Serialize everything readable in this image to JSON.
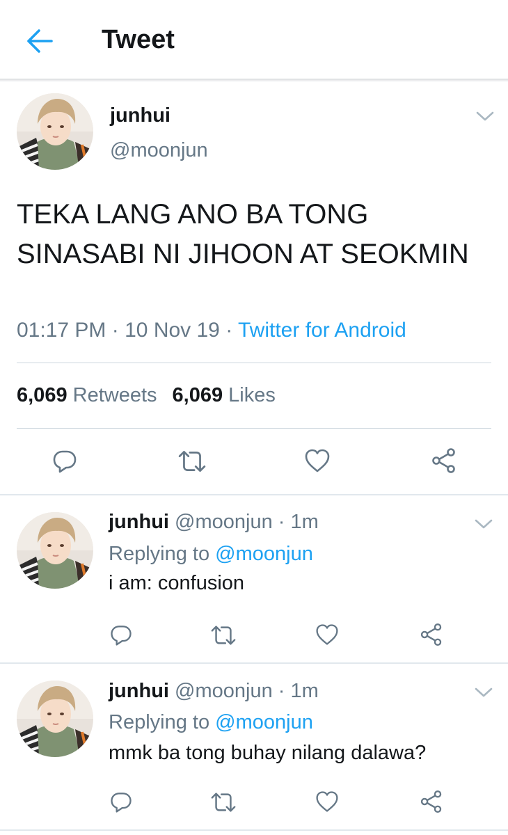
{
  "header": {
    "title": "Tweet"
  },
  "main_tweet": {
    "name": "junhui",
    "handle": "@moonjun",
    "text": "TEKA LANG ANO BA TONG SINASABI NI JIHOON AT SEOKMIN",
    "time": "01:17 PM",
    "date": "10 Nov 19",
    "dot": "·",
    "source": "Twitter for Android",
    "retweets_count": "6,069",
    "retweets_label": "Retweets",
    "likes_count": "6,069",
    "likes_label": "Likes"
  },
  "replies": [
    {
      "name": "junhui",
      "handle": "@moonjun",
      "time": "· 1m",
      "replying_label": "Replying to",
      "replying_to": "@moonjun",
      "text": "i am: confusion"
    },
    {
      "name": "junhui",
      "handle": "@moonjun",
      "time": "· 1m",
      "replying_label": "Replying to",
      "replying_to": "@moonjun",
      "text": "mmk ba tong buhay nilang dalawa?"
    }
  ],
  "colors": {
    "accent": "#1da1f2",
    "secondary_text": "#657786",
    "primary_text": "#14171a",
    "divider": "#e1e8ed"
  },
  "icons": [
    "back-arrow-icon",
    "chevron-down-icon",
    "reply-icon",
    "retweet-icon",
    "like-icon",
    "share-icon"
  ]
}
